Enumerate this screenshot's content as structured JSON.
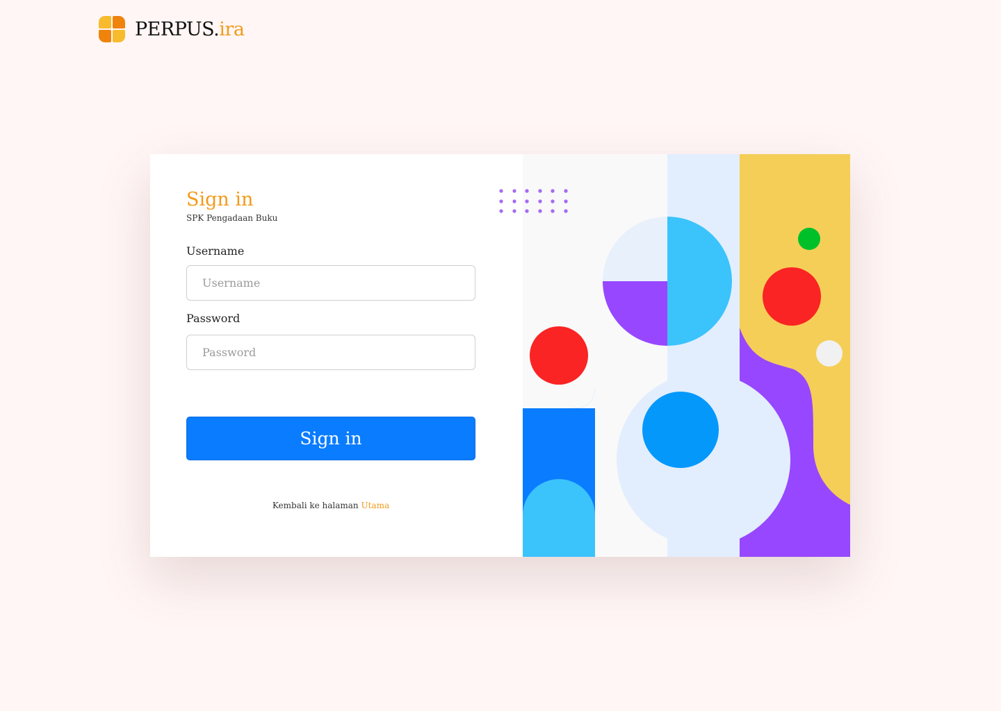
{
  "brand": {
    "name": "PERPUS.",
    "suffix": "ira"
  },
  "login": {
    "title": "Sign in",
    "subtitle": "SPK Pengadaan Buku",
    "username_label": "Username",
    "username_placeholder": "Username",
    "username_value": "",
    "password_label": "Password",
    "password_placeholder": "Password",
    "password_value": "",
    "submit_label": "Sign in",
    "back_text": "Kembali ke halaman ",
    "back_link": "Utama"
  },
  "colors": {
    "background": "#fff6f5",
    "accent_orange": "#f29a1a",
    "primary_blue": "#0a7cff",
    "art_yellow": "#f5ce57",
    "art_purple": "#9747ff",
    "art_red": "#fa2424",
    "art_light_blue": "#3bc3fc",
    "art_green": "#00c02a"
  },
  "icons": {
    "logo": "four-petal-logo-icon"
  }
}
